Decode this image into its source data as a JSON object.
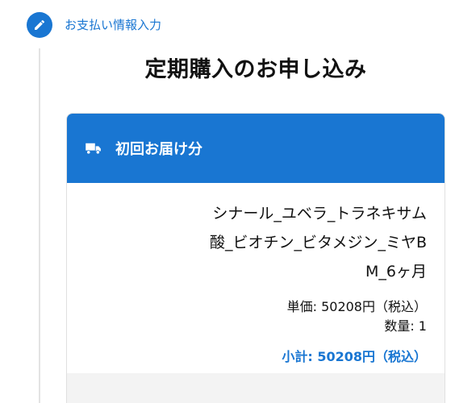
{
  "step": {
    "label": "お支払い情報入力",
    "icon": "pencil-icon",
    "accent_color": "#1976d2"
  },
  "page_title": "定期購入のお申し込み",
  "delivery_card": {
    "header_title": "初回お届け分",
    "header_icon": "truck-icon",
    "header_color": "#1976d2",
    "product_name": "シナール_ユベラ_トラネキサム酸_ビオチン_ビタメジン_ミヤBM_6ヶ月",
    "unit_price": "単価: 50208円（税込）",
    "quantity": "数量: 1",
    "subtotal": "小計: 50208円（税込）"
  }
}
